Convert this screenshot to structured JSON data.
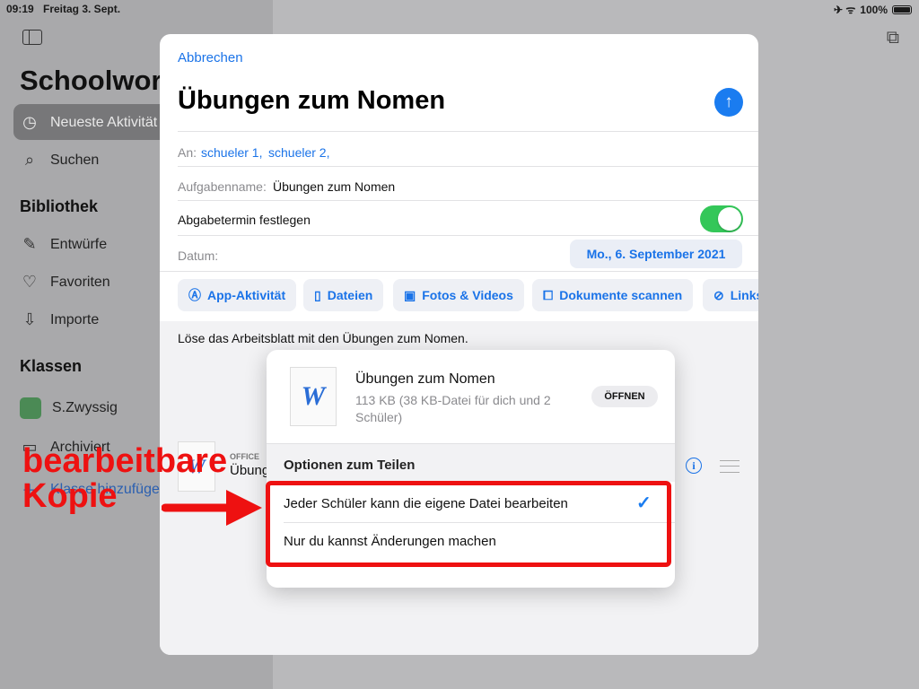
{
  "status_bar": {
    "time": "09:19",
    "date": "Freitag 3. Sept.",
    "right_icons": "✈ ᯤ",
    "battery": "100%"
  },
  "sidebar": {
    "title": "Schoolwork",
    "items": [
      {
        "label": "Neueste Aktivität",
        "icon": "clock-icon"
      },
      {
        "label": "Suchen",
        "icon": "search-icon"
      }
    ],
    "library_heading": "Bibliothek",
    "library_items": [
      {
        "label": "Entwürfe",
        "icon": "pencil-square-icon"
      },
      {
        "label": "Favoriten",
        "icon": "heart-icon"
      },
      {
        "label": "Importe",
        "icon": "import-tray-icon"
      }
    ],
    "classes_heading": "Klassen",
    "classes": [
      {
        "label": "S.Zwyssig",
        "color": "#4b8a55"
      }
    ],
    "archived": "Archiviert",
    "add_class": "Klasse hinzufügen"
  },
  "sheet": {
    "cancel": "Abbrechen",
    "title": "Übungen zum Nomen",
    "to_label": "An:",
    "recipients": [
      "schueler 1,",
      "schueler 2,"
    ],
    "task_label": "Aufgabenname:",
    "task_value": "Übungen zum Nomen",
    "due_label": "Abgabetermin festlegen",
    "due_toggle": true,
    "date_label": "Datum:",
    "date_value": "Mo., 6. September 2021",
    "attach_buttons": [
      {
        "label": "App-Aktivität",
        "icon": "app-store-icon"
      },
      {
        "label": "Dateien",
        "icon": "document-icon"
      },
      {
        "label": "Fotos & Videos",
        "icon": "photo-icon"
      },
      {
        "label": "Dokumente scannen",
        "icon": "scan-icon"
      },
      {
        "label": "Links",
        "icon": "compass-icon"
      }
    ],
    "instructions": "Löse das Arbeitsblatt mit den Übungen zum Nomen.",
    "attachment": {
      "source": "OFFICE",
      "name": "Übungen zum Nomen"
    }
  },
  "popover": {
    "file_name": "Übungen zum Nomen",
    "file_meta": "113 KB (38 KB-Datei für dich und 2 Schüler)",
    "open_button": "ÖFFNEN",
    "section_title": "Optionen zum Teilen",
    "options": [
      {
        "label": "Jeder Schüler kann die eigene Datei bearbeiten",
        "selected": true
      },
      {
        "label": "Nur du kannst Änderungen machen",
        "selected": false
      }
    ]
  },
  "annotation": {
    "line1": "bearbeitbare",
    "line2": "Kopie",
    "color": "#ee1111"
  },
  "colors": {
    "accent": "#1a73e8",
    "toggle_on": "#34c759"
  }
}
